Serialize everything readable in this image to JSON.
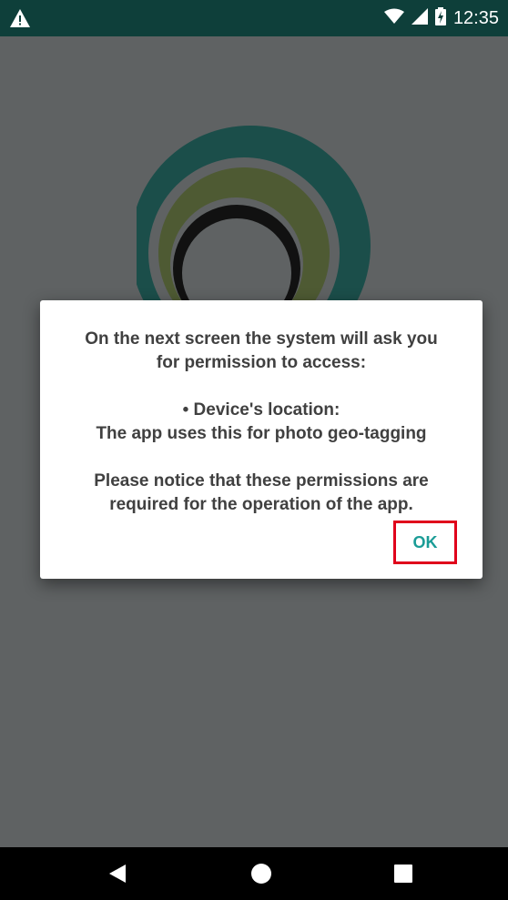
{
  "status_bar": {
    "time": "12:35",
    "left_icon": "warning-icon",
    "right_icons": [
      "wifi-icon",
      "signal-icon",
      "battery-charging-icon"
    ]
  },
  "dialog": {
    "line1": "On the next screen the system will ask you",
    "line2": "for permission to access:",
    "line3": "• Device's location:",
    "line4": "The app uses this for photo geo-tagging",
    "line5": "Please notice that these permissions are",
    "line6": "required for the operation of the app.",
    "ok_label": "OK"
  },
  "nav_bar": {
    "back": "back-icon",
    "home": "home-icon",
    "recents": "recents-icon"
  },
  "colors": {
    "status_bar": "#0e3f3a",
    "scrim": "#5f6263",
    "accent": "#1a9c96",
    "highlight": "#e0001b",
    "logo_outer": "#1b4e4a",
    "logo_middle": "#4e5a33",
    "logo_inner": "#111111"
  }
}
